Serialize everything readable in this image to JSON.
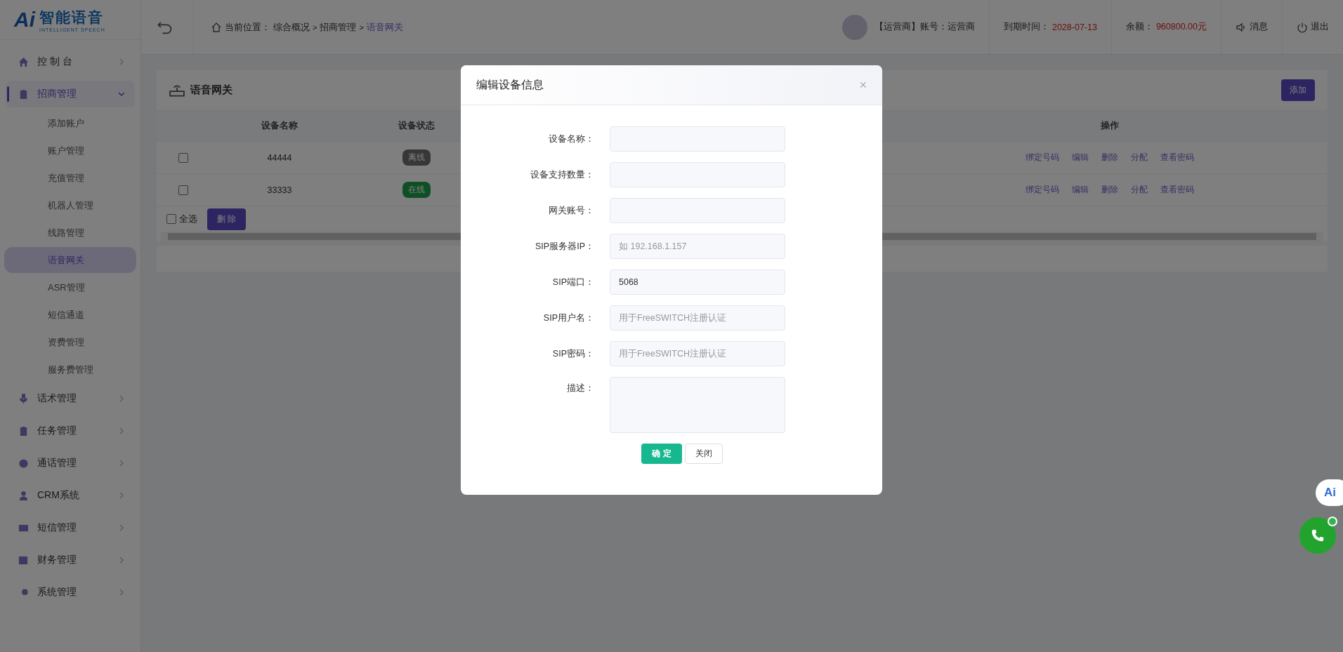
{
  "logo": {
    "mark": "Ai",
    "name": "智能语音",
    "subtitle": "INTELLIGENT SPEECH"
  },
  "sidebar": {
    "items": [
      {
        "label": "控 制 台",
        "expanded": false,
        "selected": false
      },
      {
        "label": "招商管理",
        "expanded": true,
        "selected": true,
        "children": [
          {
            "label": "添加账户",
            "selected": false
          },
          {
            "label": "账户管理",
            "selected": false
          },
          {
            "label": "充值管理",
            "selected": false
          },
          {
            "label": "机器人管理",
            "selected": false
          },
          {
            "label": "线路管理",
            "selected": false
          },
          {
            "label": "语音网关",
            "selected": true
          },
          {
            "label": "ASR管理",
            "selected": false
          },
          {
            "label": "短信通道",
            "selected": false
          },
          {
            "label": "资费管理",
            "selected": false
          },
          {
            "label": "服务费管理",
            "selected": false
          }
        ]
      },
      {
        "label": "话术管理",
        "expanded": false,
        "selected": false
      },
      {
        "label": "任务管理",
        "expanded": false,
        "selected": false
      },
      {
        "label": "通话管理",
        "expanded": false,
        "selected": false
      },
      {
        "label": "CRM系统",
        "expanded": false,
        "selected": false
      },
      {
        "label": "短信管理",
        "expanded": false,
        "selected": false
      },
      {
        "label": "财务管理",
        "expanded": false,
        "selected": false
      },
      {
        "label": "系统管理",
        "expanded": false,
        "selected": false
      }
    ]
  },
  "header": {
    "breadcrumb_label": "当前位置：",
    "breadcrumb": [
      {
        "label": "综合概况",
        "selected": false
      },
      {
        "label": "招商管理",
        "selected": false
      },
      {
        "label": "语音网关",
        "selected": true
      }
    ],
    "separator": ">",
    "account": "【运营商】账号：运营商",
    "expiry_label": "到期时间：",
    "expiry": "2028-07-13",
    "balance_label": "余额：",
    "balance": "960800.00元",
    "messages": "消息",
    "logout": "退出"
  },
  "panel": {
    "title": "语音网关",
    "add_button": "添加",
    "table": {
      "columns": [
        "设备名称",
        "设备状态",
        "操作"
      ],
      "rows": [
        {
          "checked": false,
          "name": "44444",
          "status": "离线",
          "online": false,
          "actions": [
            "绑定号码",
            "编辑",
            "删除",
            "分配",
            "查看密码"
          ]
        },
        {
          "checked": false,
          "name": "33333",
          "status": "在线",
          "online": true,
          "actions": [
            "绑定号码",
            "编辑",
            "删除",
            "分配",
            "查看密码"
          ]
        }
      ]
    },
    "select_all": {
      "label": "全选",
      "checked": false
    },
    "delete_button": "删 除"
  },
  "dialog": {
    "title": "编辑设备信息",
    "close": "×",
    "fields": [
      {
        "kind": "input",
        "label": "设备名称："
      },
      {
        "kind": "input",
        "label": "设备支持数量："
      },
      {
        "kind": "input",
        "label": "网关账号："
      },
      {
        "kind": "input",
        "label": "SIP服务器IP：",
        "placeholder": "如 192.168.1.157"
      },
      {
        "kind": "input",
        "label": "SIP端口：",
        "value": "5068"
      },
      {
        "kind": "input",
        "label": "SIP用户名：",
        "placeholder": "用于FreeSWITCH注册认证"
      },
      {
        "kind": "input",
        "label": "SIP密码：",
        "placeholder": "用于FreeSWITCH注册认证"
      },
      {
        "kind": "textarea",
        "label": "描述："
      }
    ],
    "confirm": "确 定",
    "cancel": "关闭"
  },
  "float": {
    "badge": "Ai"
  }
}
